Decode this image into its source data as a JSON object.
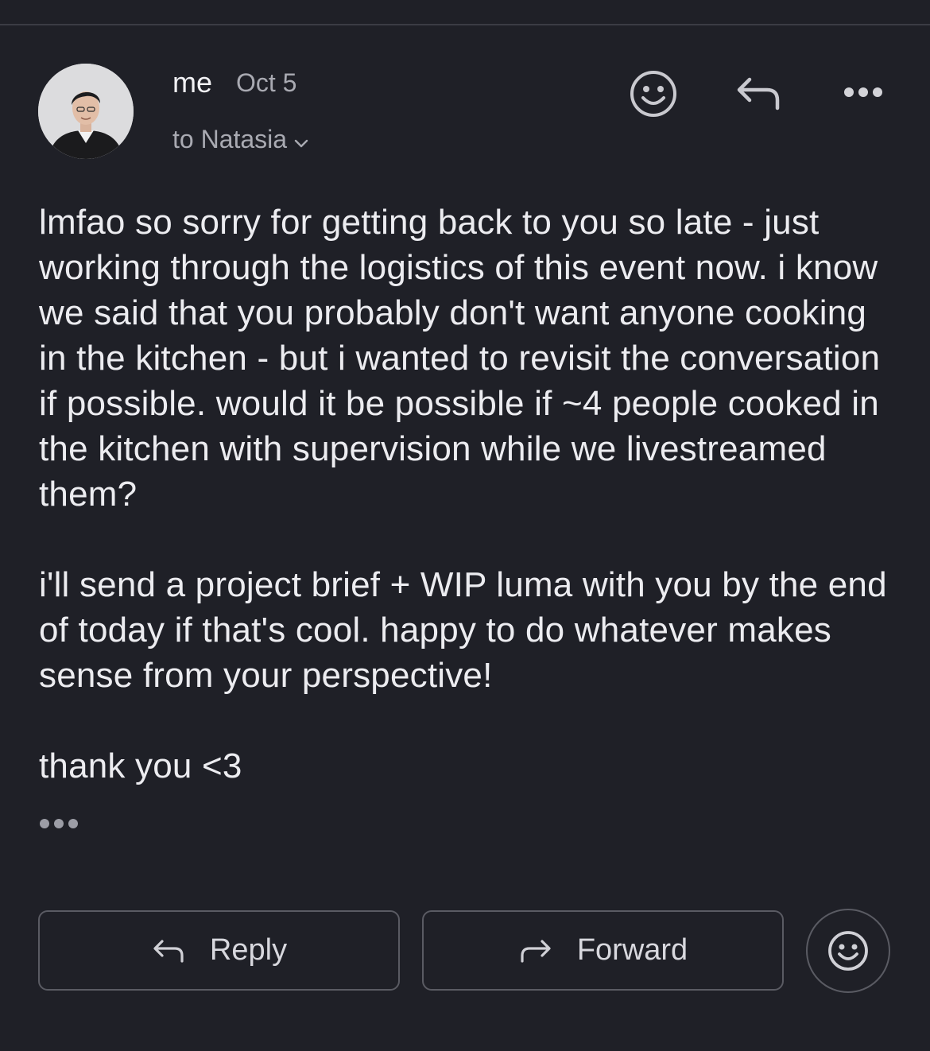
{
  "message": {
    "sender": "me",
    "date": "Oct 5",
    "recipient": "to Natasia",
    "body": {
      "paragraph1": "lmfao so sorry for getting back to you so late - just working through the logistics of this event now. i know we said that you probably don't want anyone cooking in the kitchen - but i wanted to revisit the conversation if possible. would it be possible if ~4 people cooked in the kitchen with supervision while we livestreamed them?",
      "paragraph2": "i'll send a project brief + WIP luma with you by the end of today if that's cool. happy to do whatever makes sense from your perspective!",
      "paragraph3": "thank you <3"
    }
  },
  "icons": {
    "header_emoji": "smiley-face-icon",
    "header_reply": "reply-arrow-icon",
    "header_more": "more-horizontal-icon",
    "recipient_expand": "chevron-down-icon",
    "trimmed_content": "ellipsis-icon",
    "bottom_emoji": "smiley-face-icon"
  },
  "actions": {
    "reply_label": "Reply",
    "forward_label": "Forward"
  },
  "colors": {
    "background": "#1f2027",
    "text_primary": "#ececf0",
    "text_secondary": "#a9aab2",
    "border": "#5a5b63"
  }
}
